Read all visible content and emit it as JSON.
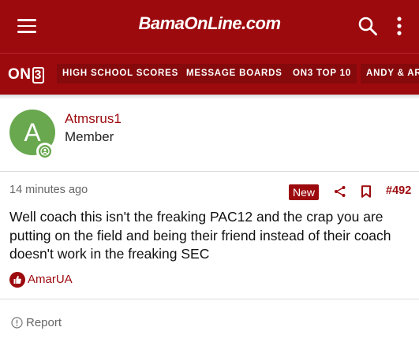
{
  "header": {
    "menu_icon": "hamburger-menu-icon",
    "logo_text": "BamaOnLine.com",
    "search_icon": "search-icon",
    "more_icon": "vertical-dots-icon",
    "brand_color": "#9c0a0e"
  },
  "nav": {
    "brand_prefix": "ON",
    "brand_suffix": "3",
    "tabs": [
      {
        "label": "HIGH SCHOOL SCORES"
      },
      {
        "label": "MESSAGE BOARDS"
      },
      {
        "label": "ON3 TOP 10"
      },
      {
        "label": "ANDY & ARI"
      }
    ]
  },
  "author": {
    "avatar_letter": "A",
    "avatar_color": "#69a84f",
    "online_icon": "online-status-icon",
    "username": "Atmsrus1",
    "role": "Member"
  },
  "post": {
    "timestamp": "14 minutes ago",
    "badge": "New",
    "share_icon": "share-icon",
    "bookmark_icon": "bookmark-icon",
    "number": "#492",
    "body": "Well coach this isn't the freaking PAC12 and the crap you are putting on the field and being their friend instead of their coach doesn't work in the freaking SEC",
    "reaction_icon": "thumbs-up-icon",
    "reactor": "AmarUA",
    "report_icon": "alert-circle-icon",
    "report_label": "Report"
  }
}
